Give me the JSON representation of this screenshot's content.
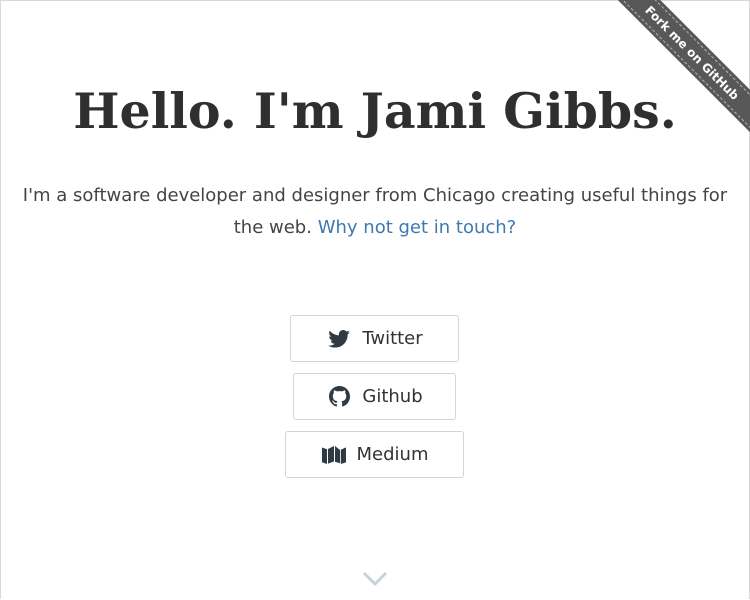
{
  "ribbon": {
    "label": "Fork me on GitHub",
    "color": "#585858"
  },
  "hero": {
    "title": "Hello. I'm Jami Gibbs.",
    "intro_text": "I'm a software developer and designer from Chicago creating useful things for the web.",
    "intro_link": "Why not get in touch?",
    "link_color": "#3e78b2"
  },
  "social": {
    "twitter": {
      "label": "Twitter",
      "icon": "twitter-icon"
    },
    "github": {
      "label": "Github",
      "icon": "github-icon"
    },
    "medium": {
      "label": "Medium",
      "icon": "medium-icon"
    }
  },
  "scroll": {
    "icon": "chevron-down-icon"
  }
}
